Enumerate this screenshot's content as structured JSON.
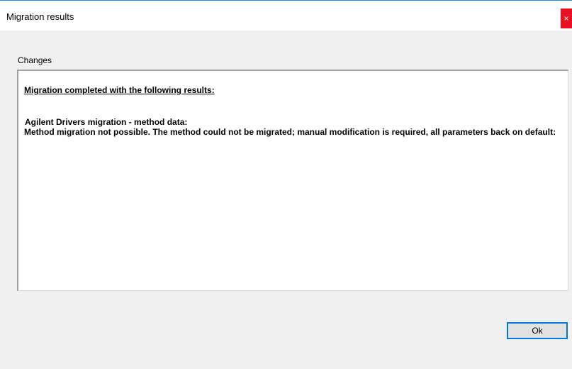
{
  "window": {
    "title": "Migration results",
    "close_glyph": "×"
  },
  "changes": {
    "label": "Changes",
    "heading": "Migration completed with the following results:",
    "lines": [
      "Agilent Drivers migration - method data:",
      "Method migration not possible. The method could not be migrated; manual modification is required, all parameters back on default:"
    ]
  },
  "buttons": {
    "ok_label": "Ok"
  },
  "colors": {
    "close_button": "#e81123",
    "title_border": "#2b8ad8",
    "focus_border": "#0078d7",
    "dialog_background": "#f0f0f0"
  },
  "icons": {
    "close": "close-icon"
  }
}
